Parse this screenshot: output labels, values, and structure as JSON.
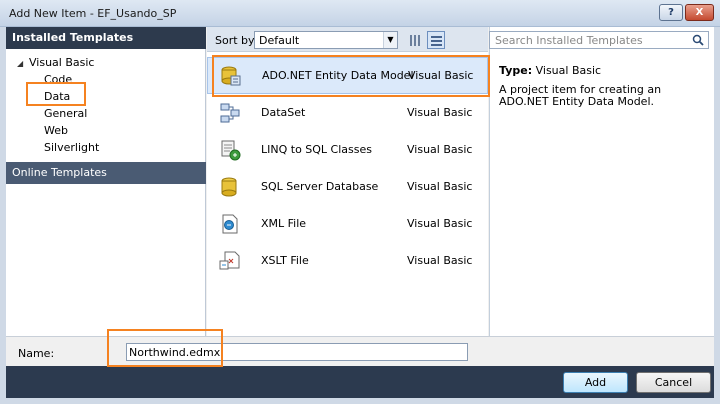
{
  "window": {
    "title": "Add New Item - EF_Usando_SP",
    "help_label": "?",
    "close_label": "X"
  },
  "left": {
    "installed_header": "Installed Templates",
    "root": {
      "label": "Visual Basic",
      "arrow": "◢"
    },
    "children": [
      "Code",
      "Data",
      "General",
      "Web",
      "Silverlight"
    ],
    "online_header": "Online Templates"
  },
  "toolbar": {
    "sort_label": "Sort by:",
    "sort_value": "Default",
    "sort_arrow": "▼"
  },
  "items": [
    {
      "name": "ADO.NET Entity Data Model",
      "lang": "Visual Basic",
      "icon": "entity-model-icon",
      "selected": true
    },
    {
      "name": "DataSet",
      "lang": "Visual Basic",
      "icon": "dataset-icon"
    },
    {
      "name": "LINQ to SQL Classes",
      "lang": "Visual Basic",
      "icon": "linq-icon"
    },
    {
      "name": "SQL Server Database",
      "lang": "Visual Basic",
      "icon": "database-icon"
    },
    {
      "name": "XML File",
      "lang": "Visual Basic",
      "icon": "xml-file-icon"
    },
    {
      "name": "XSLT File",
      "lang": "Visual Basic",
      "icon": "xslt-file-icon"
    }
  ],
  "right": {
    "search_placeholder": "Search Installed Templates",
    "type_label": "Type:",
    "type_value": "Visual Basic",
    "description": "A project item for creating an ADO.NET Entity Data Model."
  },
  "bottom": {
    "name_label": "Name:",
    "name_value": "Northwind.edmx",
    "add_label": "Add",
    "cancel_label": "Cancel"
  },
  "colors": {
    "highlight": "#f58220",
    "header_dark": "#2d3a4d",
    "selection": "#dbe9fa"
  }
}
